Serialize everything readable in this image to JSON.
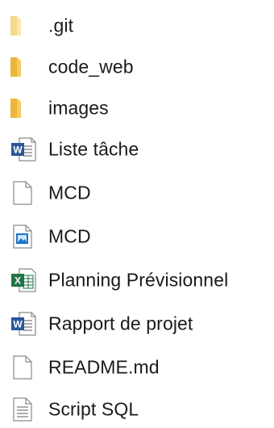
{
  "explorer": {
    "items": [
      {
        "name": ".git",
        "icon": "folder-faded-icon"
      },
      {
        "name": "code_web",
        "icon": "folder-icon"
      },
      {
        "name": "images",
        "icon": "folder-icon"
      },
      {
        "name": "Liste tâche",
        "icon": "word-document-icon"
      },
      {
        "name": "MCD",
        "icon": "blank-file-icon"
      },
      {
        "name": "MCD",
        "icon": "image-file-icon"
      },
      {
        "name": "Planning Prévisionnel",
        "icon": "excel-spreadsheet-icon"
      },
      {
        "name": "Rapport de projet",
        "icon": "word-document-icon"
      },
      {
        "name": "README.md",
        "icon": "blank-file-icon"
      },
      {
        "name": "Script SQL",
        "icon": "text-file-icon"
      }
    ]
  },
  "colors": {
    "folder": "#f4c34f",
    "folder_faded": "#f9dfa0",
    "word_blue": "#2b579a",
    "excel_green": "#217346",
    "image_blue": "#1e73c8"
  }
}
